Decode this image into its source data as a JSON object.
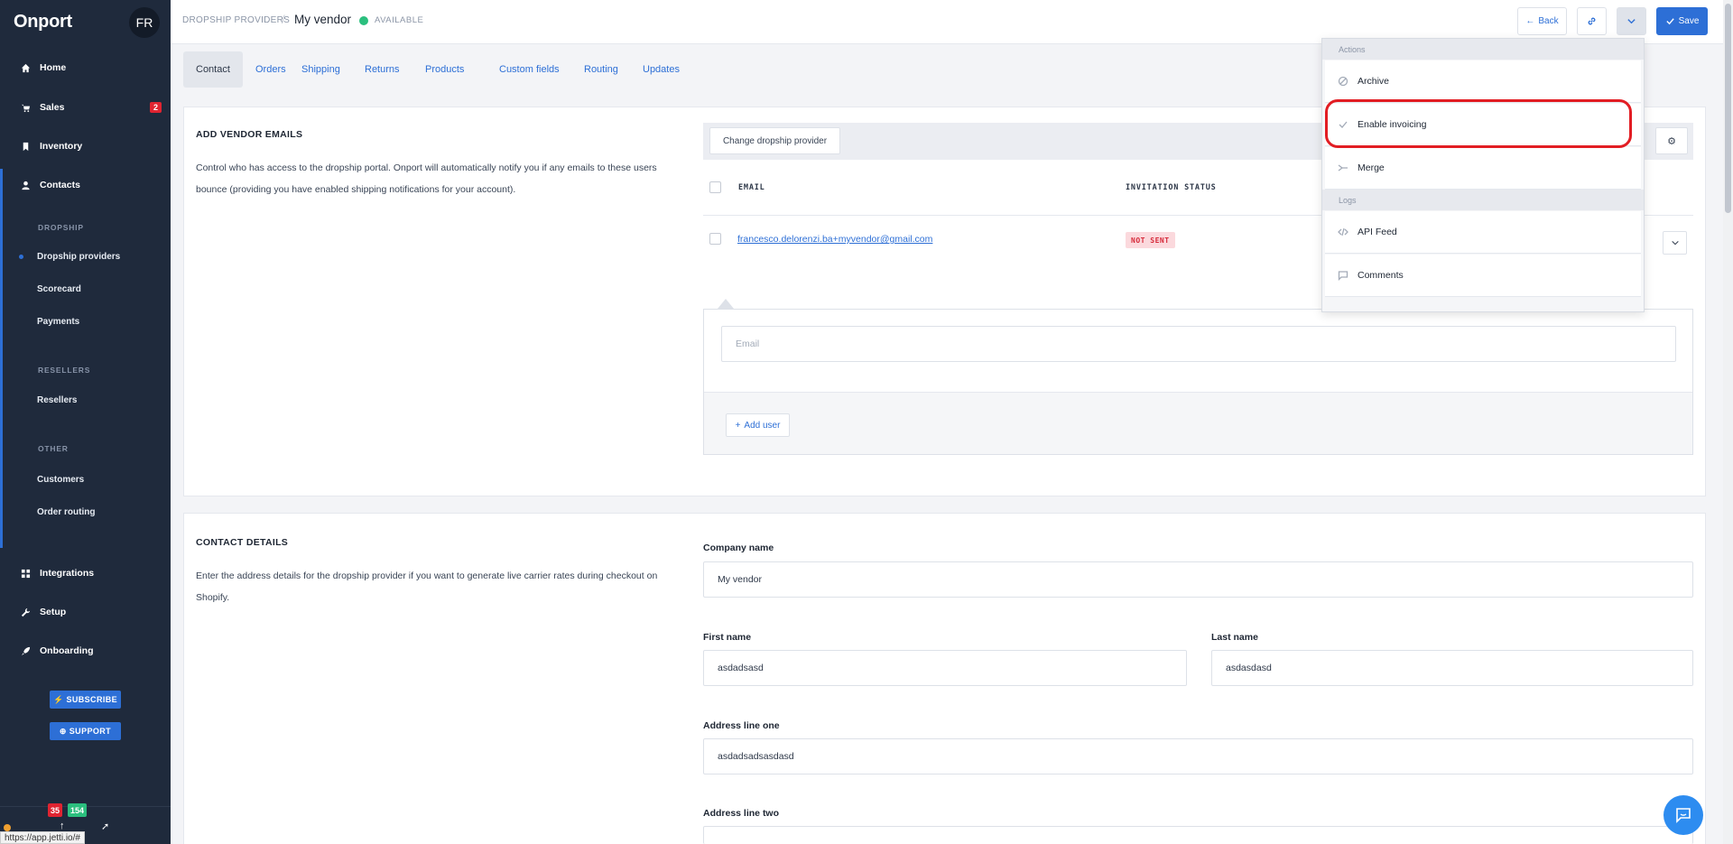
{
  "app": {
    "logo": "Onport",
    "avatar": "FR"
  },
  "sidebar": {
    "items": [
      {
        "label": "Home",
        "icon": "home-icon"
      },
      {
        "label": "Sales",
        "icon": "cart-icon",
        "badge": "2"
      },
      {
        "label": "Inventory",
        "icon": "bookmark-icon"
      },
      {
        "label": "Contacts",
        "icon": "user-icon"
      },
      {
        "label": "Integrations",
        "icon": "grid-icon"
      },
      {
        "label": "Setup",
        "icon": "wrench-icon"
      },
      {
        "label": "Onboarding",
        "icon": "rocket-icon"
      }
    ],
    "sections": {
      "dropship": "DROPSHIP",
      "resellers": "RESELLERS",
      "other": "OTHER"
    },
    "sub": {
      "dropship_providers": "Dropship providers",
      "scorecard": "Scorecard",
      "payments": "Payments",
      "resellers": "Resellers",
      "customers": "Customers",
      "order_routing": "Order routing"
    },
    "subscribe": "SUBSCRIBE",
    "support": "SUPPORT",
    "counter_red": "35",
    "counter_green": "154"
  },
  "header": {
    "breadcrumb": "DROPSHIP PROVIDERS",
    "separator": "/",
    "title": "My vendor",
    "status": "AVAILABLE",
    "back": "Back",
    "save": "Save"
  },
  "tabs": [
    "Contact",
    "Orders",
    "Shipping",
    "Returns",
    "Products",
    "Custom fields",
    "Routing",
    "Updates"
  ],
  "emails_section": {
    "title": "ADD VENDOR EMAILS",
    "description": "Control who has access to the dropship portal. Onport will automatically notify you if any emails to these users bounce (providing you have enabled shipping notifications for your account).",
    "change_provider": "Change dropship provider",
    "col_email": "EMAIL",
    "col_invitation": "INVITATION STATUS",
    "rows": [
      {
        "email": "francesco.delorenzi.ba+myvendor@gmail.com",
        "status": "NOT SENT"
      }
    ],
    "email_placeholder": "Email",
    "add_user": "Add user"
  },
  "contact_section": {
    "title": "CONTACT DETAILS",
    "description": "Enter the address details for the dropship provider if you want to generate live carrier rates during checkout on Shopify.",
    "company_label": "Company name",
    "company_value": "My vendor",
    "first_label": "First name",
    "first_value": "asdadsasd",
    "last_label": "Last name",
    "last_value": "asdasdasd",
    "addr1_label": "Address line one",
    "addr1_value": "asdadsadsasdasd",
    "addr2_label": "Address line two"
  },
  "dropdown": {
    "actions_header": "Actions",
    "archive": "Archive",
    "enable_invoicing": "Enable invoicing",
    "merge": "Merge",
    "logs_header": "Logs",
    "api_feed": "API Feed",
    "comments": "Comments"
  },
  "status_url": "https://app.jetti.io/#",
  "colors": {
    "accent": "#2d6fd6",
    "sidebar": "#1f2a3c",
    "available": "#2bbf7e",
    "highlight": "#e21d23"
  }
}
